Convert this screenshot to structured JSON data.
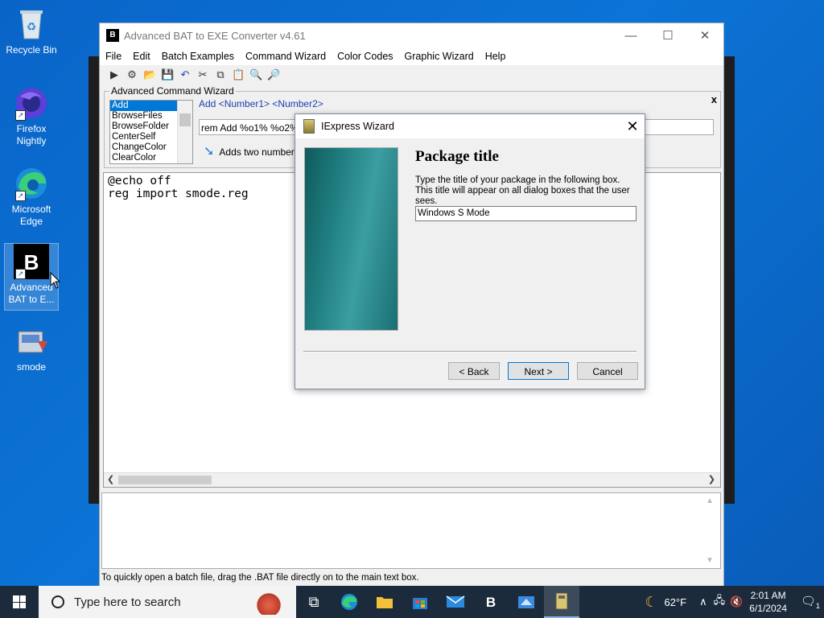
{
  "desktop": {
    "icons": [
      {
        "label": "Recycle Bin"
      },
      {
        "label": "Firefox Nightly"
      },
      {
        "label": "Microsoft Edge"
      },
      {
        "label": "Advanced BAT to E..."
      },
      {
        "label": "smode"
      }
    ]
  },
  "app": {
    "title": "Advanced BAT to EXE Converter v4.61",
    "icon_text": "B",
    "window_controls": {
      "minimize": "—",
      "maximize": "☐",
      "close": "✕"
    },
    "menu": [
      "File",
      "Edit",
      "Batch Examples",
      "Command Wizard",
      "Color Codes",
      "Graphic Wizard",
      "Help"
    ],
    "wizard": {
      "legend": "Advanced Command Wizard",
      "close": "x",
      "commands": [
        "Add",
        "BrowseFiles",
        "BrowseFolder",
        "CenterSelf",
        "ChangeColor",
        "ClearColor"
      ],
      "selected": "Add",
      "syntax": "Add  <Number1> <Number2>",
      "input_value": "rem Add %o1% %o2%",
      "description": "Adds two numbers a"
    },
    "editor_text": "@echo off\nreg import smode.reg",
    "status": "To quickly open a batch file, drag the .BAT file directly on to the main text box."
  },
  "dialog": {
    "title": "IExpress Wizard",
    "close": "✕",
    "heading": "Package title",
    "instructions": "Type the title of your package in the following  box.  This title will appear on all dialog boxes that the user sees.",
    "input_value": "Windows S Mode",
    "back_label": "< Back",
    "next_label": "Next >",
    "cancel_label": "Cancel"
  },
  "taskbar": {
    "search_placeholder": "Type here to search",
    "weather": "62°F",
    "time": "2:01 AM",
    "date": "6/1/2024",
    "notification_count": "1"
  },
  "colors": {
    "desktop": "#0b74d6",
    "taskbar": "#1b2b3c",
    "selection": "#0078d7"
  }
}
